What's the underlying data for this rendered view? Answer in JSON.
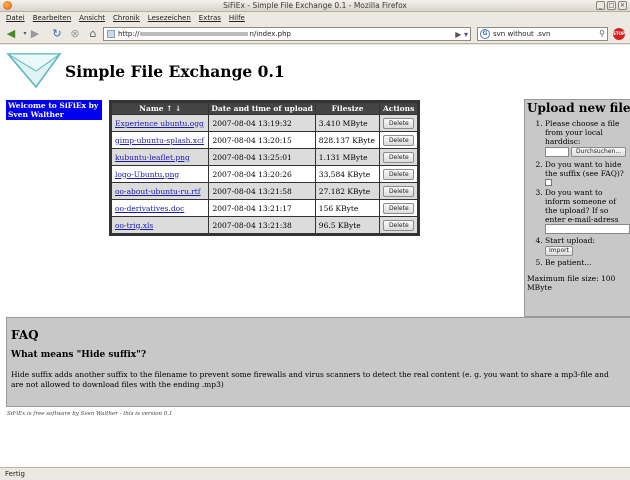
{
  "window": {
    "title": "SiFiEx - Simple File Exchange 0.1 - Mozilla Firefox"
  },
  "menu": [
    "Datei",
    "Bearbeiten",
    "Ansicht",
    "Chronik",
    "Lesezeichen",
    "Extras",
    "Hilfe"
  ],
  "nav": {
    "url_prefix": "http://",
    "url_suffix": "n/index.php",
    "search_value": "svn without .svn"
  },
  "page": {
    "title": "Simple File Exchange 0.1",
    "welcome": "Welcome to SiFiEx by Sven Walther",
    "table": {
      "headers": [
        "Name ↑ ↓",
        "Date and time of upload",
        "Filesize",
        "Actions"
      ],
      "rows": [
        {
          "name": "Experience ubuntu.ogg",
          "date": "2007-08-04 13:19:32",
          "size": "3.410 MByte",
          "action": "Delete"
        },
        {
          "name": "gimp-ubuntu-splash.xcf",
          "date": "2007-08-04 13:20:15",
          "size": "828.137 KByte",
          "action": "Delete"
        },
        {
          "name": "kubuntu-leaflet.png",
          "date": "2007-08-04 13:25:01",
          "size": "1.131 MByte",
          "action": "Delete"
        },
        {
          "name": "logo-Ubuntu.png",
          "date": "2007-08-04 13:20:26",
          "size": "33.584 KByte",
          "action": "Delete"
        },
        {
          "name": "oo-about-ubuntu-ru.rtf",
          "date": "2007-08-04 13:21:58",
          "size": "27.182 KByte",
          "action": "Delete"
        },
        {
          "name": "oo-derivatives.doc",
          "date": "2007-08-04 13:21:17",
          "size": "156 KByte",
          "action": "Delete"
        },
        {
          "name": "oo-trig.xls",
          "date": "2007-08-04 13:21:38",
          "size": "96.5 KByte",
          "action": "Delete"
        }
      ]
    },
    "upload": {
      "heading": "Upload new file",
      "step1": "Please choose a file from your local harddisc:",
      "browse_label": "Durchsuchen...",
      "step2": "Do you want to hide the suffix (see FAQ)?",
      "step3": "Do you want to inform someone of the upload? If so enter e-mail-adress",
      "step4": "Start upload:",
      "import_label": "Import",
      "step5": "Be patient...",
      "max_size": "Maximum file size: 100 MByte"
    },
    "faq": {
      "heading": "FAQ",
      "question": "What means \"Hide suffix\"?",
      "answer": "Hide suffix adds another suffix to the filename to prevent some firewalls and virus scanners to detect the real content (e. g. you want to share a mp3-file and are not allowed to download files with the ending .mp3)"
    },
    "footer": "SiFiEx is free software by Sven Walther - this is version 0.1"
  },
  "status": {
    "text": "Fertig"
  },
  "colors": {
    "welcome_bg": "#0000ee",
    "panel_bg": "#c8c8c8",
    "header_bg": "#444444",
    "row_alt": "#dcdcdc"
  }
}
